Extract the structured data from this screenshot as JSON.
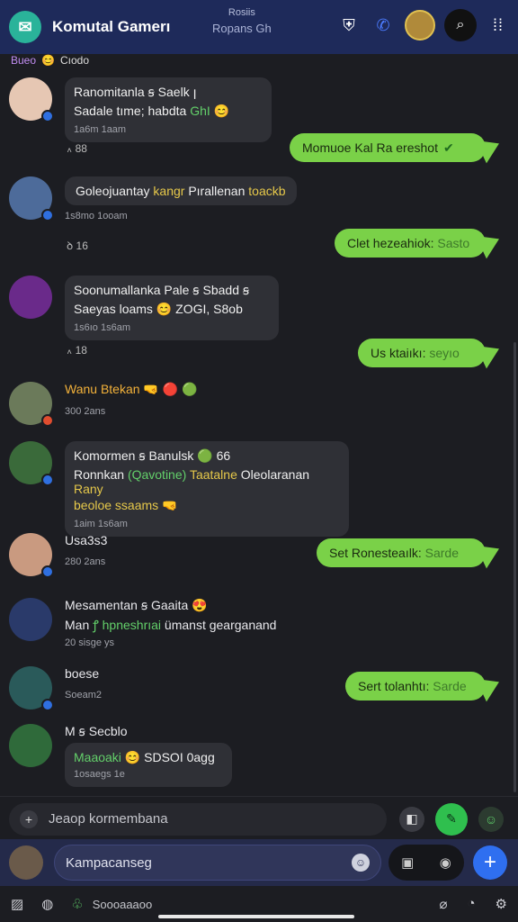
{
  "header": {
    "title": "Komutal Gamerı",
    "sub1": "Rosiis",
    "sub2": "Ropans Gh",
    "logo_icon": "chat-logo",
    "colors": {
      "bar": "#1e2a5a",
      "outgoing": "#7ad148",
      "send": "#2f6ff0"
    }
  },
  "strip": {
    "tag": "Bueo",
    "label": "Cıodo"
  },
  "messages": [
    {
      "name": "Ranomitanla ꞩ Saelk ꞁ",
      "body": "Sadale tıme; habdta",
      "body_hl": "GhI",
      "meta": "1a6m 1aam",
      "react": "꘍ 88"
    },
    {
      "out": "Momuoe Kal Ra ereshot"
    },
    {
      "body": "Goleojuantay",
      "body_hl": "kangr",
      "body2": "Pırallenan",
      "body_hl2": "toackb",
      "meta": "1s8mo 1ooam",
      "react": "ꝺ 16"
    },
    {
      "out": "Clet hezeahiok:",
      "out_dim": "Sasto"
    },
    {
      "name": "Soonumallanka Pale ꞩ Sbadd ꞩ",
      "body": "Saeyas loams",
      "body2": "ZOGI, S8ob",
      "meta": "1s6ıo 1s6am",
      "react": "꘍ 18"
    },
    {
      "out": "Us ktaiıkı:",
      "out_dim": "seyıo"
    },
    {
      "name": "Wanu Btekan",
      "meta": "300 2ans"
    },
    {
      "name": "Komormen ꞩ Banulsk",
      "name_tail": "66",
      "body": "Ronnkan",
      "body_hl": "(Qavotine)",
      "body_hl2": "Taatalne",
      "body3": "Oleolaranan",
      "body_hl3": "Rany",
      "body_line2": "beoloe ssaams",
      "meta": "1aim 1s6am"
    },
    {
      "name": "Usa3s3",
      "meta": "280 2ans"
    },
    {
      "out": "Set Ronesteaılk:",
      "out_dim": "Sarde"
    },
    {
      "name": "Mesamentan ꞩ Gaaita",
      "body": "Man",
      "body_hl": "ꝭ hpneshrıai",
      "body2": "ümanst gearganand",
      "meta": "20 sisge ys"
    },
    {
      "name": "boese",
      "meta": "Soeam2"
    },
    {
      "out": "Sert tolanhtı:",
      "out_dim": "Sarde"
    },
    {
      "name": "M ꞩ Secblo",
      "body": "Maaoaki",
      "body2": "SDSOI 0agg",
      "meta": "1osaegs 1e"
    }
  ],
  "input1": {
    "placeholder": "Jeaop kormembana",
    "plus": "+"
  },
  "input2": {
    "placeholder": "Kampacanseg",
    "send": "+"
  },
  "bottom": {
    "label": "Soooaaaoo"
  }
}
